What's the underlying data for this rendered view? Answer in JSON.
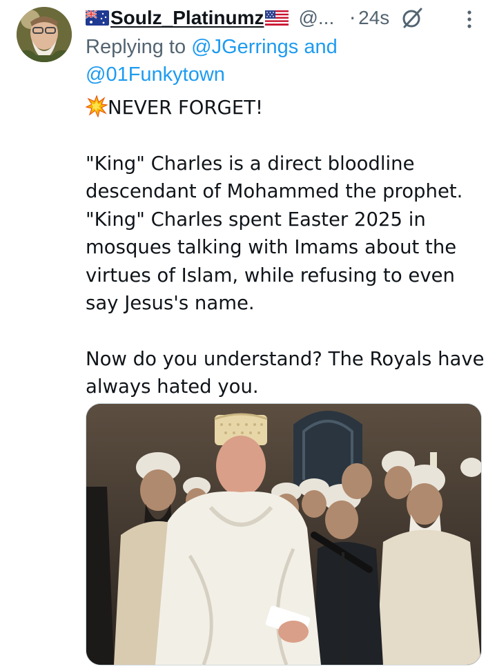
{
  "author": {
    "flag_left": "australia-flag-icon",
    "display_name": "Soulz_Platinumz",
    "flag_right": "usa-flag-icon",
    "handle": "@...",
    "separator": "·",
    "time": "24s"
  },
  "reply": {
    "prefix": "Replying to",
    "mention_1": "@JGerrings",
    "and": "and",
    "mention_2": "@01Funkytown"
  },
  "body": {
    "line_1": "NEVER FORGET!",
    "paragraph_2": "\"King\" Charles is a direct bloodline descendant of Mohammed the prophet. \"King\" Charles spent Easter 2025 in mosques talking with Imams about the virtues of Islam, while refusing to even say Jesus's name.",
    "paragraph_3": "Now do you understand? The Royals have always hated you."
  },
  "icons": {
    "grok": "grok-icon",
    "more": "more-vertical-icon",
    "emoji": "collision-emoji-icon"
  },
  "colors": {
    "link": "#1d9bf0",
    "secondary_text": "#536471",
    "primary_text": "#0f1419"
  }
}
